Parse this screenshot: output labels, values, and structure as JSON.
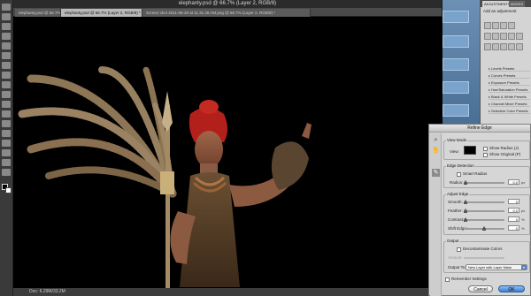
{
  "window": {
    "title": "elephanty.psd @ 66.7% (Layer 2, RGB/8)"
  },
  "tabs": [
    {
      "label": "elephanty.psd @ 66.7% (Layer 2, RGB/8) *",
      "active": false
    },
    {
      "label": "elephanty.psd @ 66.7% (Layer 2, RGB/8) *",
      "active": true
    },
    {
      "label": "Screen shot 2011-06-29 at 11.31.46 AM.png @ 66.7% (Layer 2, RGB/8) *",
      "active": false
    }
  ],
  "status": {
    "text": "Doc: 6.29M/33.2M"
  },
  "adjustments_panel": {
    "tab_adjustments": "ADJUSTMENTS",
    "tab_masks": "MASKS",
    "title": "Add an adjustment",
    "presets": [
      "Levels Presets",
      "Curves Presets",
      "Exposure Presets",
      "Hue/Saturation Presets",
      "Black & White Presets",
      "Channel Mixer Presets",
      "Selective Color Presets"
    ]
  },
  "dialog": {
    "title": "Refine Edge",
    "view_mode": {
      "group_title": "View Mode",
      "view_label": "View:",
      "show_radius": "Show Radius (J)",
      "show_original": "Show Original (P)"
    },
    "edge_detection": {
      "group_title": "Edge Detection",
      "smart_radius": "Smart Radius",
      "radius_label": "Radius:",
      "radius_value": "0.0",
      "radius_unit": "px"
    },
    "adjust_edge": {
      "group_title": "Adjust Edge",
      "rows": [
        {
          "label": "Smooth:",
          "value": "0",
          "unit": ""
        },
        {
          "label": "Feather:",
          "value": "0.0",
          "unit": "px"
        },
        {
          "label": "Contrast:",
          "value": "0",
          "unit": "%"
        },
        {
          "label": "Shift Edge:",
          "value": "0",
          "unit": "%"
        }
      ]
    },
    "output": {
      "group_title": "Output",
      "decontaminate": "Decontaminate Colors",
      "amount_label": "Amount:",
      "output_to_label": "Output To:",
      "output_to_value": "New Layer with Layer Mask"
    },
    "remember": "Remember Settings",
    "cancel_label": "Cancel",
    "ok_label": "OK"
  },
  "colors": {
    "canvas_bg": "#000000",
    "ok_button": "#3a7ed4",
    "hair": "#b3201b"
  }
}
